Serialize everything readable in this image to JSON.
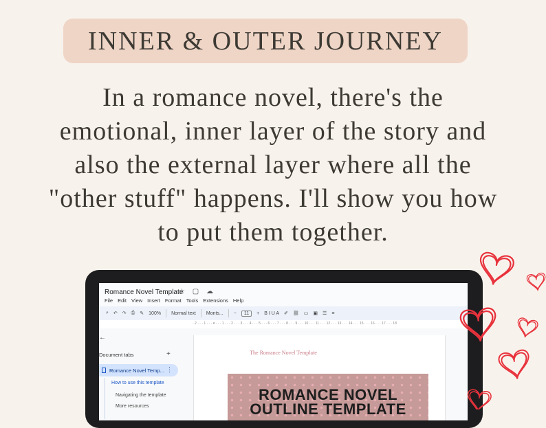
{
  "heading": "INNER & OUTER JOURNEY",
  "description_lines": [
    "In a romance novel, there's the",
    "emotional, inner layer of the story and",
    "also the external layer where all the",
    "\"other stuff\" happens. I'll show you how",
    "to put them together."
  ],
  "doc": {
    "title": "Romance Novel Template",
    "title_icons": "☆ ▢ ☁",
    "menu": [
      "File",
      "Edit",
      "View",
      "Insert",
      "Format",
      "Tools",
      "Extensions",
      "Help"
    ],
    "toolbar": {
      "zoom": "100%",
      "style": "Normal text",
      "font": "Monts...",
      "size": "11",
      "format_glyphs": "B I U A"
    },
    "ruler_text": "· 2 · · · 1 · · · ▾ · · · 1 · · · 2 · · · 3 · · · 4 · · · 5 · · · 6 · · · 7 · · · 8 · · · 9 · · · 10 · · · 11 · · · 12 · · · 13 · · · 14 · · · 15 · · · 16 · · · 17 · · · 18",
    "sidebar": {
      "header": "Document tabs",
      "active_tab": "Romance Novel Temp...",
      "outline": [
        "How to use this template",
        "Navigating the template",
        "More resources"
      ]
    },
    "page_header": "The Romance Novel Template",
    "banner_lines": [
      "ROMANCE NOVEL",
      "OUTLINE TEMPLATE"
    ]
  },
  "colors": {
    "background": "#f8f2ec",
    "pill": "#efd5c6",
    "text": "#3d3a34",
    "heart": "#e8323c",
    "banner": "#c69a98"
  }
}
